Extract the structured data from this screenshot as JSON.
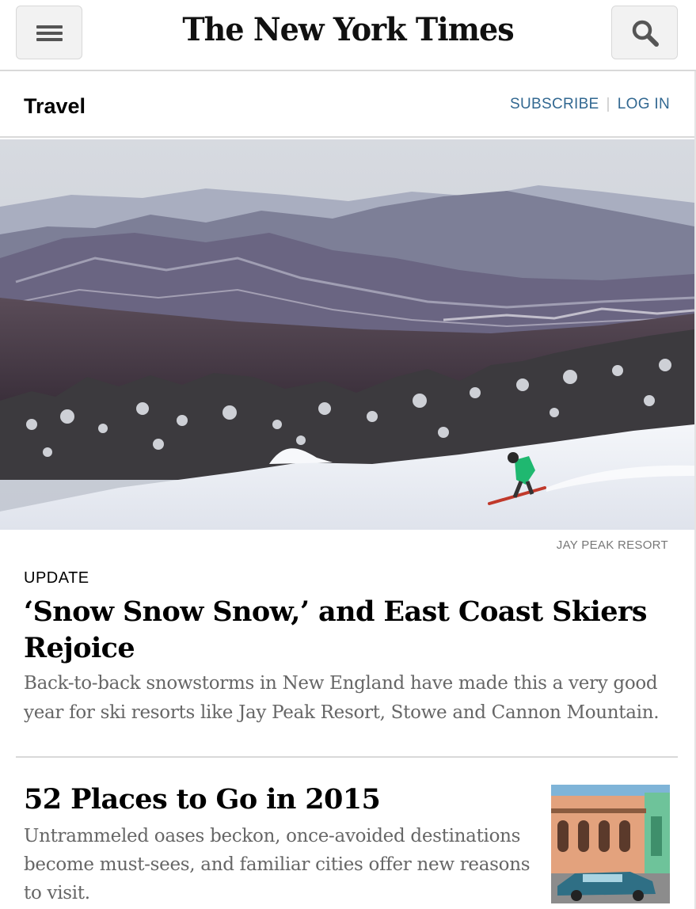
{
  "header": {
    "logo_text": "The New York Times",
    "menu_icon": "hamburger-menu-icon",
    "search_icon": "search-icon"
  },
  "section": {
    "title": "Travel",
    "subscribe_label": "SUBSCRIBE",
    "separator": "|",
    "login_label": "LOG IN",
    "link_color": "#326891"
  },
  "lead_story": {
    "image_credit": "JAY PEAK RESORT",
    "kicker": "UPDATE",
    "headline": "‘Snow Snow Snow,’ and East Coast Skiers Rejoice",
    "summary": "Back-to-back snowstorms in New England have made this a very good year for ski resorts like Jay Peak Resort, Stowe and Cannon Mountain."
  },
  "second_story": {
    "headline": "52 Places to Go in 2015",
    "summary": "Untrammeled oases beckon, once-avoided destinations become must-sees, and familiar cities offer new reasons to visit."
  },
  "colors": {
    "summary_text": "#666666",
    "divider": "#d9d9d9",
    "button_bg": "#f2f2f2"
  }
}
